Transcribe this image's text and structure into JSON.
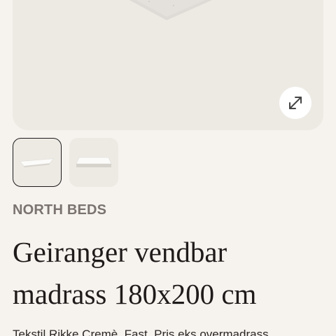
{
  "gallery": {
    "main_image": "mattress-top-view-image",
    "expand_icon": "expand-diagonal-arrows-icon",
    "thumbnails": [
      {
        "icon": "mattress-thumbnail-image",
        "selected": true
      },
      {
        "icon": "mattress-thumbnail-image",
        "selected": false
      }
    ]
  },
  "product": {
    "brand": "NORTH BEDS",
    "title": "Geiranger vendbar madrass 180x200 cm",
    "description_partial": "Tekstil Rikke Cremè. Fast. Pris eks overmadrass"
  },
  "colors": {
    "background": "#f6f3ef",
    "image_panel": "#edeae4",
    "brand_text": "#7a7370",
    "title_text": "#1e1b1a"
  }
}
